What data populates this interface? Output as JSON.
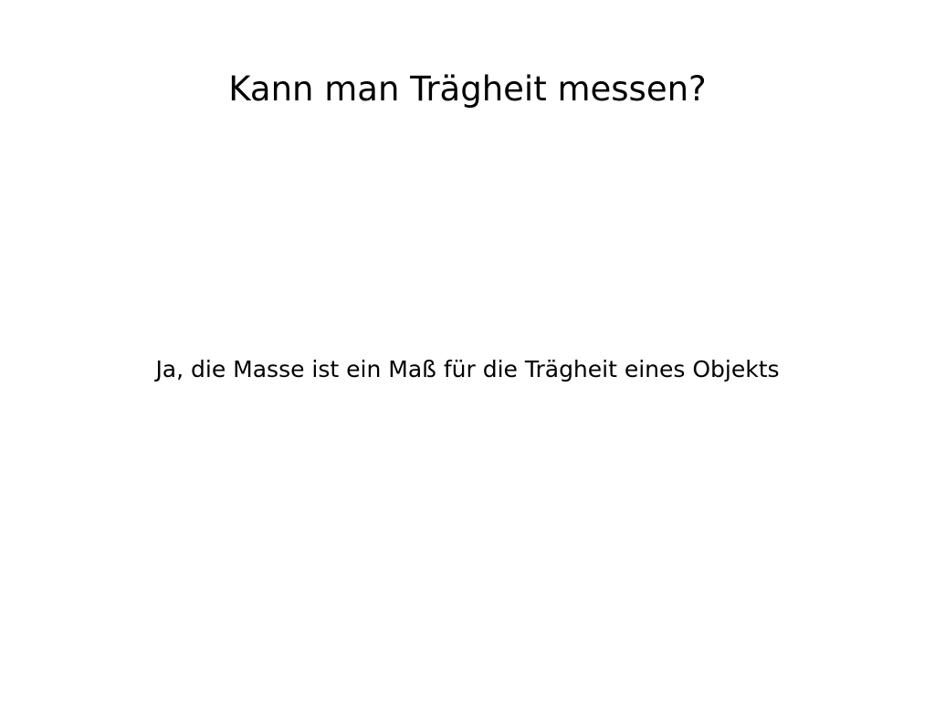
{
  "slide": {
    "title": "Kann man Trägheit messen?",
    "body": "Ja, die Masse ist ein Maß für die Trägheit eines Objekts"
  }
}
